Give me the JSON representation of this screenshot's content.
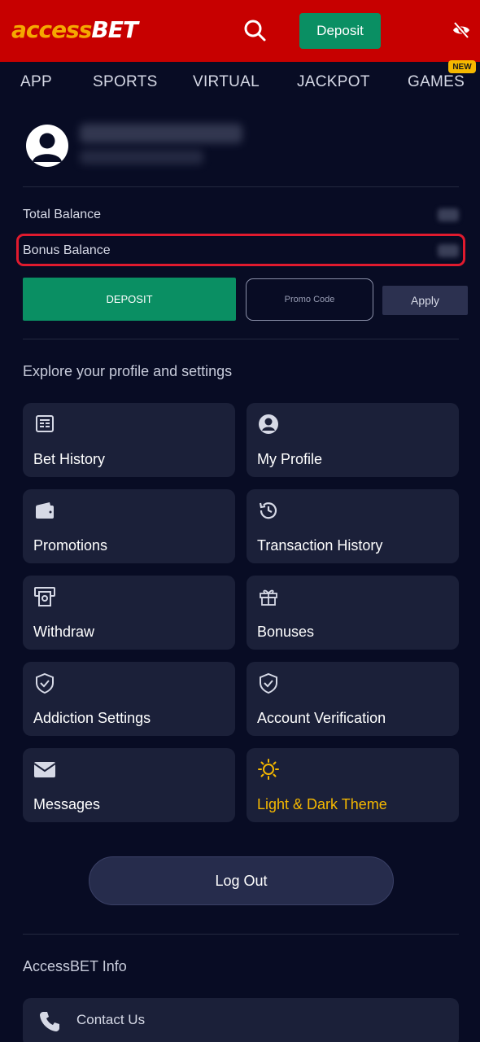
{
  "header": {
    "logo_part1": "access",
    "logo_part2": "BET",
    "deposit_label": "Deposit"
  },
  "nav": {
    "items": [
      {
        "label": "APP"
      },
      {
        "label": "SPORTS"
      },
      {
        "label": "VIRTUAL"
      },
      {
        "label": "JACKPOT"
      },
      {
        "label": "GAMES"
      }
    ],
    "new_badge": "NEW"
  },
  "balances": {
    "total_label": "Total Balance",
    "bonus_label": "Bonus Balance"
  },
  "actions": {
    "deposit_label": "DEPOSIT",
    "promo_placeholder": "Promo Code",
    "apply_label": "Apply"
  },
  "settings": {
    "title": "Explore your profile and settings",
    "cards": [
      {
        "label": "Bet History",
        "icon": "receipt-icon"
      },
      {
        "label": "My Profile",
        "icon": "user-circle-icon"
      },
      {
        "label": "Promotions",
        "icon": "wallet-icon"
      },
      {
        "label": "Transaction History",
        "icon": "history-icon"
      },
      {
        "label": "Withdraw",
        "icon": "atm-icon"
      },
      {
        "label": "Bonuses",
        "icon": "gift-icon"
      },
      {
        "label": "Addiction Settings",
        "icon": "shield-check-icon"
      },
      {
        "label": "Account Verification",
        "icon": "shield-check-icon"
      },
      {
        "label": "Messages",
        "icon": "envelope-icon"
      },
      {
        "label": "Light & Dark Theme",
        "icon": "sun-icon"
      }
    ]
  },
  "logout_label": "Log Out",
  "info": {
    "title": "AccessBET Info",
    "contact_label": "Contact Us"
  },
  "colors": {
    "header_bg": "#c70000",
    "page_bg": "#080c24",
    "card_bg": "#1b2039",
    "accent_green": "#0a8f63",
    "accent_gold": "#f5b800",
    "highlight_red": "#e01a2e"
  }
}
